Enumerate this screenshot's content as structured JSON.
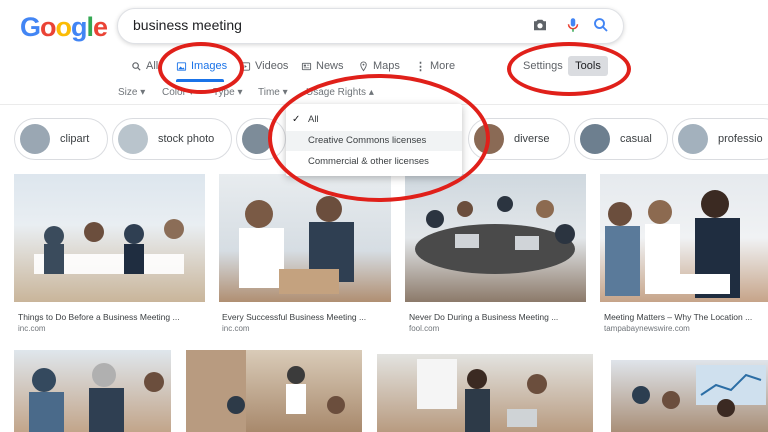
{
  "logo": {
    "letters": [
      "G",
      "o",
      "o",
      "g",
      "l",
      "e"
    ],
    "colors": [
      "#4285f4",
      "#ea4335",
      "#fbbc05",
      "#4285f4",
      "#34a853",
      "#ea4335"
    ]
  },
  "search": {
    "query": "business meeting",
    "camera_icon": "camera-icon",
    "mic_icon": "microphone-icon",
    "search_icon": "search-icon"
  },
  "nav": {
    "all": "All",
    "images": "Images",
    "videos": "Videos",
    "news": "News",
    "maps": "Maps",
    "more": "More",
    "settings": "Settings",
    "tools": "Tools"
  },
  "filters": {
    "size": "Size",
    "color": "Color",
    "type": "Type",
    "time": "Time",
    "usage_rights": "Usage Rights"
  },
  "chips": [
    {
      "label": "clipart",
      "thumb": "#9aa7b3"
    },
    {
      "label": "stock photo",
      "thumb": "#b9c4cc"
    },
    {
      "label": "",
      "thumb": "#7d8c99"
    },
    {
      "label": "diverse",
      "thumb": "#8a6a55"
    },
    {
      "label": "casual",
      "thumb": "#6d7f8f"
    },
    {
      "label": "professio",
      "thumb": "#a3b1bd"
    }
  ],
  "usage_rights_menu": {
    "items": [
      "All",
      "Creative Commons licenses",
      "Commercial & other licenses"
    ],
    "selected": "All"
  },
  "results_row1": [
    {
      "caption": "Things to Do Before a Business Meeting ...",
      "source": "inc.com",
      "colors": [
        "#dde6ee",
        "#3a4b5c",
        "#c9b59a"
      ]
    },
    {
      "caption": "Every Successful Business Meeting ...",
      "source": "inc.com",
      "colors": [
        "#e8ecef",
        "#2f3f52",
        "#b08f72"
      ]
    },
    {
      "caption": "Never Do During a Business Meeting ...",
      "source": "fool.com",
      "colors": [
        "#cfd8df",
        "#2b3440",
        "#8c7a6a"
      ]
    },
    {
      "caption": "Meeting Matters – Why The Location ...",
      "source": "tampabaynewswire.com",
      "colors": [
        "#e6eaee",
        "#1f2d40",
        "#c6a489"
      ]
    }
  ],
  "results_row2": [
    {
      "colors": [
        "#dfe6ec",
        "#34495e",
        "#c2a58a"
      ]
    },
    {
      "colors": [
        "#d9cbb8",
        "#3b3b3b",
        "#a8896c"
      ]
    },
    {
      "colors": [
        "#e3e3e0",
        "#2d3a48",
        "#b89b80"
      ]
    },
    {
      "colors": [
        "#dfe4ea",
        "#2c3e50",
        "#a98f78"
      ]
    }
  ],
  "annotation_color": "#e0201a"
}
